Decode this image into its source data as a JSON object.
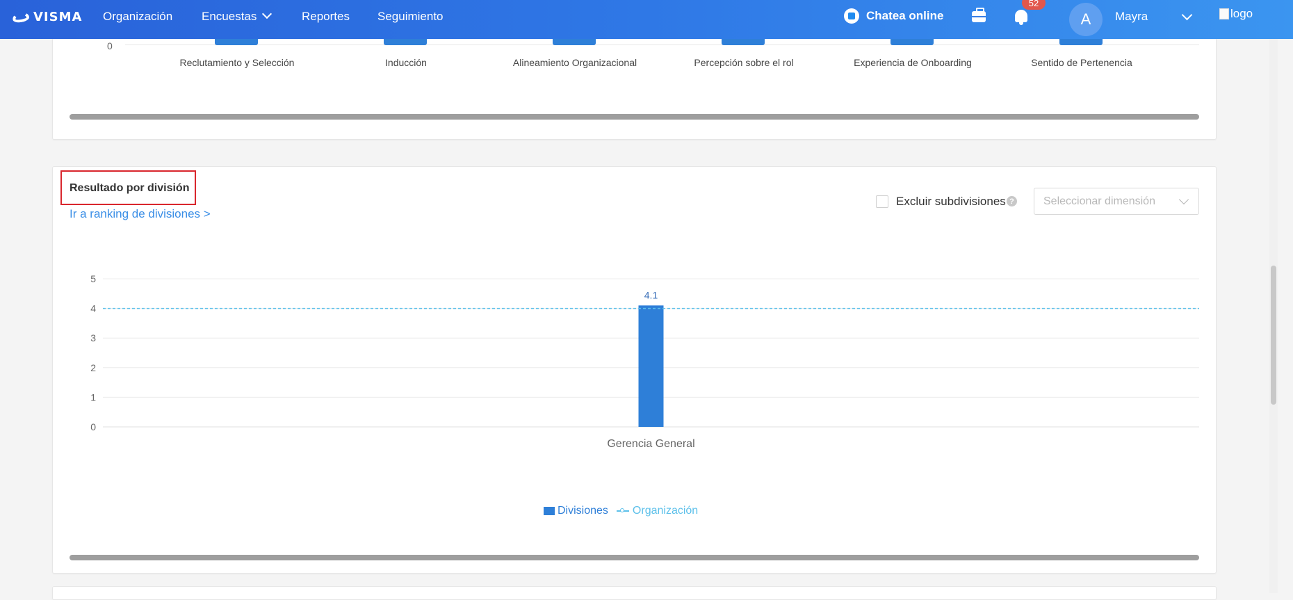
{
  "nav": {
    "brand": "VISMA",
    "items": [
      {
        "label": "Organización"
      },
      {
        "label": "Encuestas"
      },
      {
        "label": "Reportes"
      },
      {
        "label": "Seguimiento"
      }
    ],
    "chat_label": "Chatea online",
    "notifications_count": "52",
    "avatar_initial": "A",
    "user_name": "Mayra",
    "logo_alt": "logo"
  },
  "top_chart": {
    "zero_tick": "0",
    "categories": [
      "Reclutamiento y Selección",
      "Inducción",
      "Alineamiento Organizacional",
      "Percepción sobre el rol",
      "Experiencia de Onboarding",
      "Sentido de Pertenencia"
    ]
  },
  "division_section": {
    "title": "Resultado por división",
    "ranking_link": "Ir a ranking de divisiones >",
    "exclude_label": "Excluir subdivisiones",
    "help_icon": "?",
    "dimension_placeholder": "Seleccionar dimensión",
    "legend_divisions": "Divisiones",
    "legend_organization": "Organización"
  },
  "colors": {
    "bar": "#2e7fd8",
    "reference_line": "#5cc0ea",
    "highlight_box": "#d9262d"
  },
  "chart_data": {
    "type": "bar",
    "categories": [
      "Gerencia General"
    ],
    "series": [
      {
        "name": "Divisiones",
        "values": [
          4.1
        ]
      }
    ],
    "reference_line": {
      "name": "Organización",
      "value": 4
    },
    "data_labels": [
      "4.1"
    ],
    "yticks": [
      0,
      1,
      2,
      3,
      4,
      5
    ],
    "ylim": [
      0,
      5
    ],
    "grid": true,
    "legend": "bottom-center"
  }
}
